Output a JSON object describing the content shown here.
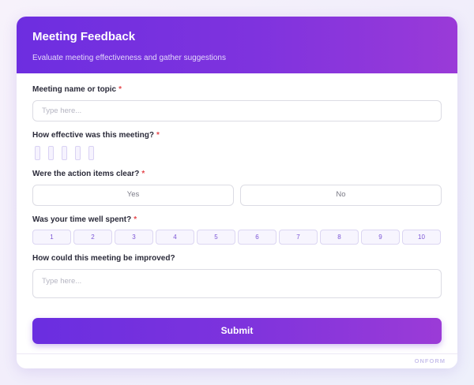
{
  "form": {
    "title": "Meeting Feedback",
    "subtitle": "Evaluate meeting effectiveness and gather suggestions",
    "required_marker": "*"
  },
  "fields": {
    "meeting_name": {
      "label": "Meeting name or topic",
      "placeholder": "Type here..."
    },
    "effectiveness": {
      "label": "How effective was this meeting?",
      "rating_max": 5
    },
    "action_items": {
      "label": "Were the action items clear?",
      "yes_label": "Yes",
      "no_label": "No"
    },
    "time_well_spent": {
      "label": "Was your time well spent?",
      "scale": [
        "1",
        "2",
        "3",
        "4",
        "5",
        "6",
        "7",
        "8",
        "9",
        "10"
      ]
    },
    "improvement": {
      "label": "How could this meeting be improved?",
      "placeholder": "Type here..."
    }
  },
  "actions": {
    "submit_label": "Submit"
  },
  "footer": {
    "brand": "ONFORM"
  },
  "colors": {
    "accent": "#7a32de",
    "required": "#e5484d"
  }
}
